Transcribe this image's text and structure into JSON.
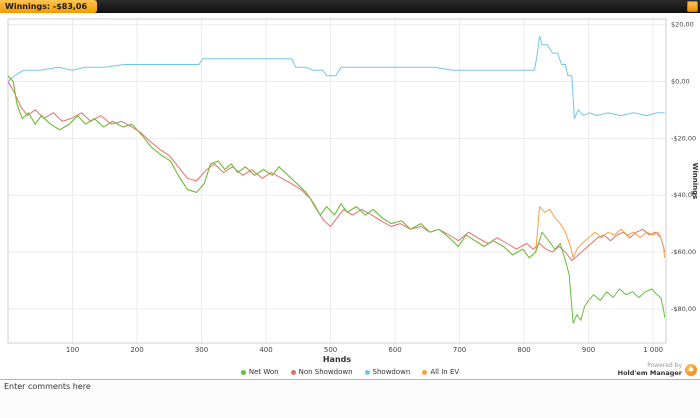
{
  "titlebar": {
    "tab_label": "Winnings: -$83,06"
  },
  "powered_by": {
    "line1": "Powered by",
    "line2": "Hold'em Manager"
  },
  "comments": {
    "placeholder": "Enter comments here"
  },
  "chart_data": {
    "type": "line",
    "title": "Winnings: -$83,06",
    "xlabel": "Hands",
    "ylabel": "Winnings",
    "xlim": [
      0,
      1020
    ],
    "ylim": [
      -92,
      22
    ],
    "grid": true,
    "legend_position": "bottom",
    "x_ticks": [
      100,
      200,
      300,
      400,
      500,
      600,
      700,
      800,
      900,
      1000
    ],
    "x_tick_labels": [
      "100",
      "200",
      "300",
      "400",
      "500",
      "600",
      "700",
      "800",
      "900",
      "1 000"
    ],
    "y_ticks": [
      20,
      0,
      -20,
      -40,
      -60,
      -80
    ],
    "y_tick_labels": [
      "$20,00",
      "$0,00",
      "-$20,00",
      "-$40,00",
      "-$60,00",
      "-$80,00"
    ],
    "series": [
      {
        "name": "Showdown",
        "color": "#72c5ed",
        "points": [
          [
            0,
            0
          ],
          [
            10,
            2
          ],
          [
            24,
            4
          ],
          [
            50,
            4
          ],
          [
            78,
            5
          ],
          [
            100,
            4
          ],
          [
            120,
            5
          ],
          [
            150,
            5
          ],
          [
            180,
            6
          ],
          [
            210,
            6
          ],
          [
            240,
            6
          ],
          [
            270,
            6
          ],
          [
            296,
            6
          ],
          [
            302,
            8
          ],
          [
            330,
            8
          ],
          [
            360,
            8
          ],
          [
            390,
            8
          ],
          [
            420,
            8
          ],
          [
            440,
            8
          ],
          [
            446,
            5
          ],
          [
            462,
            5
          ],
          [
            472,
            4
          ],
          [
            488,
            4
          ],
          [
            494,
            2
          ],
          [
            508,
            2
          ],
          [
            516,
            5
          ],
          [
            540,
            5
          ],
          [
            570,
            5
          ],
          [
            600,
            5
          ],
          [
            630,
            5
          ],
          [
            660,
            5
          ],
          [
            690,
            4
          ],
          [
            720,
            4
          ],
          [
            750,
            4
          ],
          [
            780,
            4
          ],
          [
            806,
            4
          ],
          [
            816,
            4
          ],
          [
            820,
            9
          ],
          [
            824,
            16
          ],
          [
            828,
            13
          ],
          [
            836,
            13
          ],
          [
            844,
            10
          ],
          [
            852,
            10
          ],
          [
            858,
            6
          ],
          [
            864,
            6
          ],
          [
            868,
            2
          ],
          [
            874,
            2
          ],
          [
            878,
            -13
          ],
          [
            884,
            -10
          ],
          [
            892,
            -12
          ],
          [
            902,
            -11
          ],
          [
            912,
            -12
          ],
          [
            930,
            -11
          ],
          [
            950,
            -12
          ],
          [
            970,
            -11
          ],
          [
            990,
            -12
          ],
          [
            1006,
            -11
          ],
          [
            1018,
            -11
          ]
        ]
      },
      {
        "name": "Non Showdown",
        "color": "#e2706c",
        "points": [
          [
            0,
            0
          ],
          [
            10,
            -4
          ],
          [
            20,
            -9
          ],
          [
            30,
            -12
          ],
          [
            42,
            -10
          ],
          [
            56,
            -13
          ],
          [
            70,
            -11
          ],
          [
            84,
            -14
          ],
          [
            98,
            -13
          ],
          [
            114,
            -11
          ],
          [
            128,
            -14
          ],
          [
            144,
            -12
          ],
          [
            160,
            -15
          ],
          [
            176,
            -14
          ],
          [
            192,
            -16
          ],
          [
            206,
            -18
          ],
          [
            220,
            -21
          ],
          [
            236,
            -24
          ],
          [
            250,
            -26
          ],
          [
            264,
            -30
          ],
          [
            278,
            -34
          ],
          [
            292,
            -35
          ],
          [
            308,
            -31
          ],
          [
            320,
            -29
          ],
          [
            334,
            -32
          ],
          [
            348,
            -30
          ],
          [
            364,
            -33
          ],
          [
            378,
            -31
          ],
          [
            394,
            -34
          ],
          [
            408,
            -32
          ],
          [
            424,
            -34
          ],
          [
            440,
            -36
          ],
          [
            454,
            -38
          ],
          [
            468,
            -41
          ],
          [
            478,
            -45
          ],
          [
            490,
            -49
          ],
          [
            500,
            -51
          ],
          [
            510,
            -48
          ],
          [
            520,
            -45
          ],
          [
            534,
            -47
          ],
          [
            548,
            -45
          ],
          [
            564,
            -47
          ],
          [
            578,
            -49
          ],
          [
            594,
            -51
          ],
          [
            608,
            -50
          ],
          [
            624,
            -52
          ],
          [
            640,
            -51
          ],
          [
            654,
            -53
          ],
          [
            668,
            -52
          ],
          [
            684,
            -54
          ],
          [
            698,
            -56
          ],
          [
            714,
            -53
          ],
          [
            728,
            -55
          ],
          [
            744,
            -57
          ],
          [
            758,
            -55
          ],
          [
            774,
            -57
          ],
          [
            788,
            -59
          ],
          [
            804,
            -57
          ],
          [
            814,
            -59
          ],
          [
            824,
            -57
          ],
          [
            834,
            -59
          ],
          [
            844,
            -60
          ],
          [
            854,
            -58
          ],
          [
            864,
            -60
          ],
          [
            874,
            -63
          ],
          [
            884,
            -61
          ],
          [
            894,
            -59
          ],
          [
            904,
            -57
          ],
          [
            914,
            -55
          ],
          [
            924,
            -54
          ],
          [
            934,
            -56
          ],
          [
            944,
            -54
          ],
          [
            954,
            -53
          ],
          [
            964,
            -55
          ],
          [
            974,
            -53
          ],
          [
            984,
            -52
          ],
          [
            994,
            -54
          ],
          [
            1004,
            -53
          ],
          [
            1012,
            -55
          ],
          [
            1016,
            -58
          ],
          [
            1018,
            -60
          ]
        ]
      },
      {
        "name": "All In EV",
        "color": "#f6a145",
        "points": [
          [
            0,
            2
          ],
          [
            8,
            0
          ],
          [
            14,
            -8
          ],
          [
            22,
            -13
          ],
          [
            32,
            -11
          ],
          [
            42,
            -15
          ],
          [
            52,
            -12
          ],
          [
            66,
            -15
          ],
          [
            80,
            -17
          ],
          [
            95,
            -15
          ],
          [
            108,
            -12
          ],
          [
            120,
            -15
          ],
          [
            134,
            -13
          ],
          [
            148,
            -16
          ],
          [
            162,
            -14
          ],
          [
            178,
            -16
          ],
          [
            192,
            -15
          ],
          [
            208,
            -19
          ],
          [
            222,
            -23
          ],
          [
            238,
            -26
          ],
          [
            252,
            -28
          ],
          [
            264,
            -33
          ],
          [
            278,
            -38
          ],
          [
            292,
            -39
          ],
          [
            304,
            -36
          ],
          [
            314,
            -29
          ],
          [
            326,
            -28
          ],
          [
            336,
            -31
          ],
          [
            346,
            -29
          ],
          [
            356,
            -32
          ],
          [
            368,
            -30
          ],
          [
            382,
            -33
          ],
          [
            396,
            -31
          ],
          [
            410,
            -33
          ],
          [
            420,
            -30
          ],
          [
            434,
            -33
          ],
          [
            448,
            -36
          ],
          [
            462,
            -39
          ],
          [
            474,
            -43
          ],
          [
            484,
            -47
          ],
          [
            494,
            -44
          ],
          [
            506,
            -47
          ],
          [
            516,
            -43
          ],
          [
            526,
            -46
          ],
          [
            540,
            -44
          ],
          [
            554,
            -47
          ],
          [
            566,
            -45
          ],
          [
            580,
            -48
          ],
          [
            594,
            -50
          ],
          [
            610,
            -49
          ],
          [
            624,
            -52
          ],
          [
            640,
            -50
          ],
          [
            654,
            -53
          ],
          [
            668,
            -52
          ],
          [
            684,
            -55
          ],
          [
            698,
            -58
          ],
          [
            710,
            -54
          ],
          [
            724,
            -56
          ],
          [
            738,
            -58
          ],
          [
            752,
            -56
          ],
          [
            768,
            -58
          ],
          [
            782,
            -61
          ],
          [
            798,
            -59
          ],
          [
            808,
            -62
          ],
          [
            818,
            -60
          ],
          [
            824,
            -44
          ],
          [
            832,
            -46
          ],
          [
            840,
            -45
          ],
          [
            848,
            -48
          ],
          [
            856,
            -50
          ],
          [
            864,
            -53
          ],
          [
            872,
            -58
          ],
          [
            876,
            -62
          ],
          [
            882,
            -59
          ],
          [
            890,
            -57
          ],
          [
            900,
            -55
          ],
          [
            910,
            -53
          ],
          [
            920,
            -55
          ],
          [
            930,
            -53
          ],
          [
            940,
            -54
          ],
          [
            950,
            -52
          ],
          [
            960,
            -54
          ],
          [
            970,
            -53
          ],
          [
            980,
            -55
          ],
          [
            990,
            -53
          ],
          [
            1000,
            -54
          ],
          [
            1008,
            -53
          ],
          [
            1012,
            -55
          ],
          [
            1016,
            -58
          ],
          [
            1018,
            -62
          ]
        ]
      },
      {
        "name": "Net Won",
        "color": "#62c13e",
        "points": [
          [
            0,
            2
          ],
          [
            8,
            0
          ],
          [
            14,
            -8
          ],
          [
            22,
            -13
          ],
          [
            32,
            -11
          ],
          [
            42,
            -15
          ],
          [
            52,
            -12
          ],
          [
            66,
            -15
          ],
          [
            80,
            -17
          ],
          [
            95,
            -15
          ],
          [
            108,
            -12
          ],
          [
            120,
            -15
          ],
          [
            134,
            -13
          ],
          [
            148,
            -16
          ],
          [
            162,
            -14
          ],
          [
            178,
            -16
          ],
          [
            192,
            -15
          ],
          [
            208,
            -19
          ],
          [
            222,
            -23
          ],
          [
            238,
            -26
          ],
          [
            252,
            -28
          ],
          [
            264,
            -33
          ],
          [
            278,
            -38
          ],
          [
            292,
            -39
          ],
          [
            304,
            -36
          ],
          [
            314,
            -29
          ],
          [
            326,
            -28
          ],
          [
            336,
            -31
          ],
          [
            346,
            -29
          ],
          [
            356,
            -32
          ],
          [
            368,
            -30
          ],
          [
            382,
            -33
          ],
          [
            396,
            -31
          ],
          [
            410,
            -33
          ],
          [
            420,
            -30
          ],
          [
            434,
            -33
          ],
          [
            448,
            -36
          ],
          [
            462,
            -39
          ],
          [
            474,
            -43
          ],
          [
            484,
            -47
          ],
          [
            494,
            -44
          ],
          [
            506,
            -47
          ],
          [
            516,
            -43
          ],
          [
            526,
            -46
          ],
          [
            540,
            -44
          ],
          [
            554,
            -47
          ],
          [
            566,
            -45
          ],
          [
            580,
            -48
          ],
          [
            594,
            -50
          ],
          [
            610,
            -49
          ],
          [
            624,
            -52
          ],
          [
            640,
            -50
          ],
          [
            654,
            -53
          ],
          [
            668,
            -52
          ],
          [
            684,
            -55
          ],
          [
            698,
            -58
          ],
          [
            710,
            -54
          ],
          [
            724,
            -56
          ],
          [
            738,
            -58
          ],
          [
            752,
            -56
          ],
          [
            768,
            -58
          ],
          [
            782,
            -61
          ],
          [
            798,
            -59
          ],
          [
            808,
            -62
          ],
          [
            818,
            -60
          ],
          [
            828,
            -53
          ],
          [
            838,
            -56
          ],
          [
            848,
            -59
          ],
          [
            856,
            -57
          ],
          [
            864,
            -63
          ],
          [
            870,
            -68
          ],
          [
            876,
            -85
          ],
          [
            882,
            -82
          ],
          [
            888,
            -84
          ],
          [
            894,
            -79
          ],
          [
            900,
            -77
          ],
          [
            908,
            -75
          ],
          [
            918,
            -77
          ],
          [
            928,
            -74
          ],
          [
            938,
            -76
          ],
          [
            948,
            -73
          ],
          [
            958,
            -75
          ],
          [
            968,
            -74
          ],
          [
            978,
            -76
          ],
          [
            988,
            -74
          ],
          [
            998,
            -73
          ],
          [
            1006,
            -75
          ],
          [
            1012,
            -76
          ],
          [
            1016,
            -80
          ],
          [
            1018,
            -83
          ]
        ]
      }
    ]
  }
}
